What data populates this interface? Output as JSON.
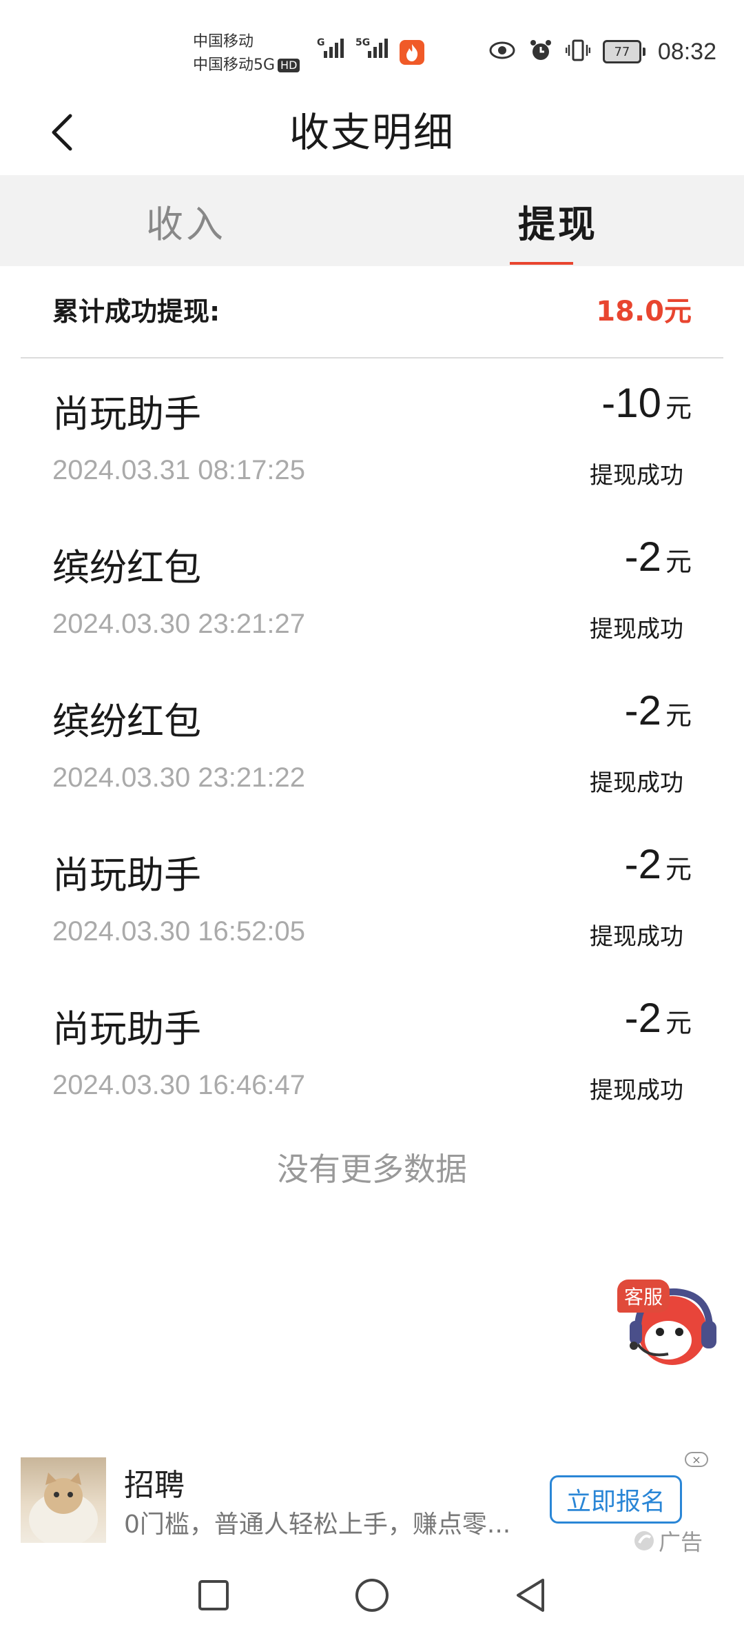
{
  "status_bar": {
    "carrier_1": "中国移动",
    "carrier_2": "中国移动5G",
    "hd_label": "HD",
    "sig1_label": "G",
    "sig2_label": "5G",
    "battery": "77",
    "time": "08:32"
  },
  "header": {
    "title": "收支明细"
  },
  "tabs": [
    {
      "label": "收入"
    },
    {
      "label": "提现"
    }
  ],
  "active_tab": "提现",
  "summary": {
    "label": "累计成功提现:",
    "value": "18.0元"
  },
  "records": [
    {
      "name": "尚玩助手",
      "amount": "-10",
      "unit": "元",
      "time": "2024.03.31 08:17:25",
      "status": "提现成功"
    },
    {
      "name": "缤纷红包",
      "amount": "-2",
      "unit": "元",
      "time": "2024.03.30 23:21:27",
      "status": "提现成功"
    },
    {
      "name": "缤纷红包",
      "amount": "-2",
      "unit": "元",
      "time": "2024.03.30 23:21:22",
      "status": "提现成功"
    },
    {
      "name": "尚玩助手",
      "amount": "-2",
      "unit": "元",
      "time": "2024.03.30 16:52:05",
      "status": "提现成功"
    },
    {
      "name": "尚玩助手",
      "amount": "-2",
      "unit": "元",
      "time": "2024.03.30 16:46:47",
      "status": "提现成功"
    }
  ],
  "no_more": "没有更多数据",
  "customer_service": {
    "badge": "客服"
  },
  "ad": {
    "title": "招聘",
    "description": "0门槛，普通人轻松上手，赚点零...",
    "cta": "立即报名",
    "close": "×",
    "tag": "广告"
  },
  "colors": {
    "accent": "#e8452f",
    "ad_blue": "#2a86d6",
    "tab_bg": "#f2f2f2"
  },
  "icons": {
    "back": "chevron-left-icon",
    "eye": "eye-icon",
    "alarm": "alarm-icon",
    "vibrate": "vibrate-icon",
    "battery": "battery-icon",
    "nav_recent": "square-icon",
    "nav_home": "circle-icon",
    "nav_back": "triangle-back-icon"
  }
}
